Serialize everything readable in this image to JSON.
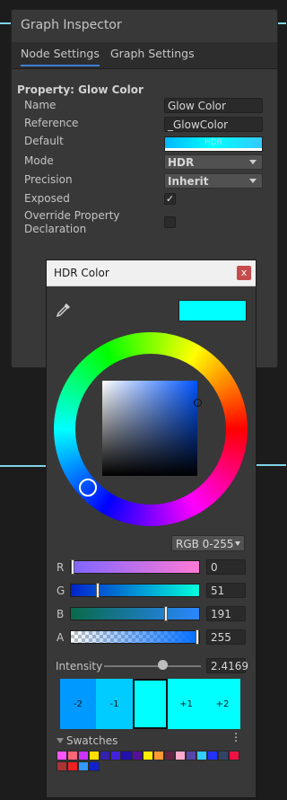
{
  "inspector": {
    "title": "Graph Inspector",
    "tabs": [
      "Node Settings",
      "Graph Settings"
    ],
    "property_heading": "Property: Glow Color",
    "fields": {
      "name_label": "Name",
      "name_value": "Glow Color",
      "reference_label": "Reference",
      "reference_value": "_GlowColor",
      "default_label": "Default",
      "default_swatch_text": "HDR",
      "mode_label": "Mode",
      "mode_value": "HDR",
      "precision_label": "Precision",
      "precision_value": "Inherit",
      "exposed_label": "Exposed",
      "exposed_checked": true,
      "override_label_line1": "Override Property",
      "override_label_line2": "Declaration",
      "override_checked": false
    }
  },
  "hdr_color": {
    "title": "HDR Color",
    "close_label": "x",
    "preview_color": "#00ffff",
    "mode_value": "RGB 0-255",
    "channels": [
      {
        "label": "R",
        "value": "0",
        "level": 0.0
      },
      {
        "label": "G",
        "value": "51",
        "level": 0.2
      },
      {
        "label": "B",
        "value": "191",
        "level": 0.749
      },
      {
        "label": "A",
        "value": "255",
        "level": 1.0
      }
    ],
    "intensity_label": "Intensity",
    "intensity_value": "2.4169",
    "stops": [
      {
        "label": "-2",
        "color": "#0099ff"
      },
      {
        "label": "-1",
        "color": "#00ccff"
      },
      {
        "label": "",
        "color": "#00ffff"
      },
      {
        "label": "+1",
        "color": "#00ffff"
      },
      {
        "label": "+2",
        "color": "#00ffff"
      }
    ],
    "swatches_label": "Swatches",
    "swatch_colors_row1": [
      "#ff55ff",
      "#ff6677",
      "#cc33ff",
      "#ffdd00",
      "#3322aa",
      "#4422dd",
      "#2211aa",
      "#551199",
      "#ffee00",
      "#ff9933",
      "#662244",
      "#ffaacc",
      "#5544aa",
      "#33ccff",
      "#2233ff",
      "#334466",
      "#ee1144"
    ],
    "swatch_colors_row2": [
      "#aa3333",
      "#ee2222",
      "#3399ff",
      "#1122cc"
    ]
  }
}
